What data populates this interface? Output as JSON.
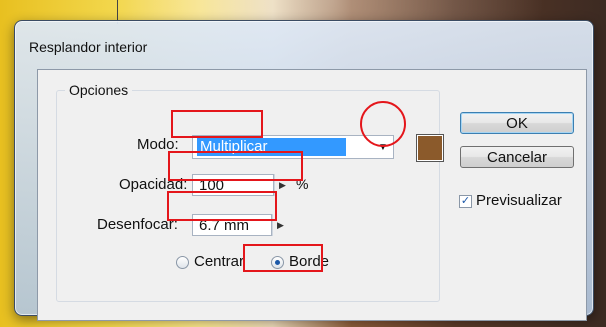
{
  "dialog": {
    "title": "Resplandor interior",
    "group_label": "Opciones",
    "mode": {
      "label": "Modo:",
      "value": "Multiplicar",
      "arrow_icon": "chevron-down-icon",
      "color_swatch": "#8b5a2b"
    },
    "opacity": {
      "label": "Opacidad:",
      "value": "100",
      "unit": "%"
    },
    "blur": {
      "label": "Desenfocar:",
      "value": "6.7 mm"
    },
    "position": {
      "options": [
        {
          "label": "Centrar",
          "selected": false
        },
        {
          "label": "Borde",
          "selected": true
        }
      ]
    },
    "buttons": {
      "ok": "OK",
      "cancel": "Cancelar"
    },
    "preview": {
      "label": "Previsualizar",
      "checked": true
    }
  },
  "annotation_color": "#e4161b"
}
